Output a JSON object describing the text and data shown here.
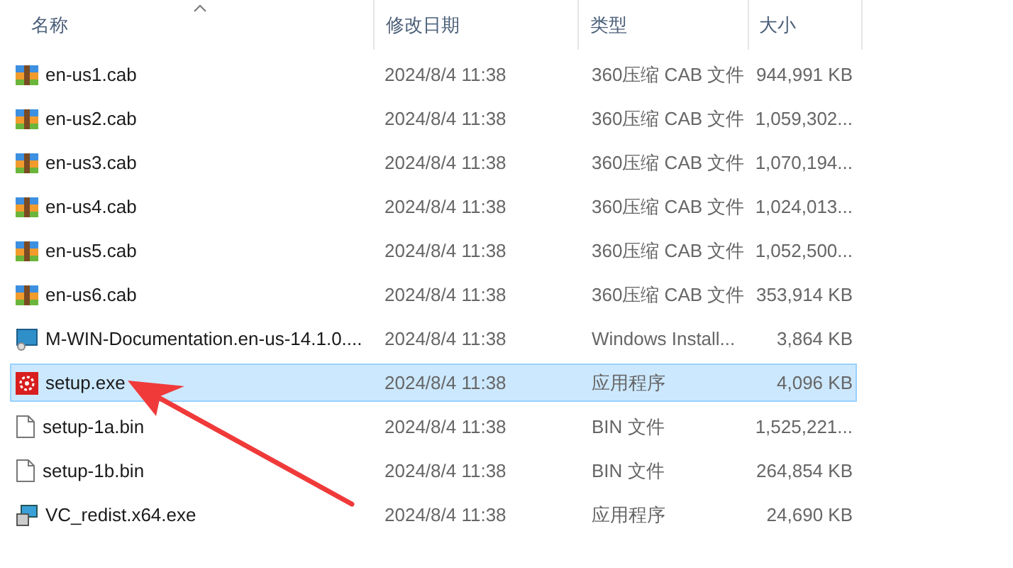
{
  "columns": [
    {
      "label": "名称",
      "sorted": true
    },
    {
      "label": "修改日期",
      "sorted": false
    },
    {
      "label": "类型",
      "sorted": false
    },
    {
      "label": "大小",
      "sorted": false
    }
  ],
  "rows": [
    {
      "kind": "archive",
      "name": "en-us1.cab",
      "date": "2024/8/4 11:38",
      "type": "360压缩 CAB 文件",
      "size": "944,991 KB",
      "selected": false
    },
    {
      "kind": "archive",
      "name": "en-us2.cab",
      "date": "2024/8/4 11:38",
      "type": "360压缩 CAB 文件",
      "size": "1,059,302...",
      "selected": false
    },
    {
      "kind": "archive",
      "name": "en-us3.cab",
      "date": "2024/8/4 11:38",
      "type": "360压缩 CAB 文件",
      "size": "1,070,194...",
      "selected": false
    },
    {
      "kind": "archive",
      "name": "en-us4.cab",
      "date": "2024/8/4 11:38",
      "type": "360压缩 CAB 文件",
      "size": "1,024,013...",
      "selected": false
    },
    {
      "kind": "archive",
      "name": "en-us5.cab",
      "date": "2024/8/4 11:38",
      "type": "360压缩 CAB 文件",
      "size": "1,052,500...",
      "selected": false
    },
    {
      "kind": "archive",
      "name": "en-us6.cab",
      "date": "2024/8/4 11:38",
      "type": "360压缩 CAB 文件",
      "size": "353,914 KB",
      "selected": false
    },
    {
      "kind": "installer",
      "name": "M-WIN-Documentation.en-us-14.1.0....",
      "date": "2024/8/4 11:38",
      "type": "Windows Install...",
      "size": "3,864 KB",
      "selected": false
    },
    {
      "kind": "app",
      "name": "setup.exe",
      "date": "2024/8/4 11:38",
      "type": "应用程序",
      "size": "4,096 KB",
      "selected": true
    },
    {
      "kind": "file",
      "name": "setup-1a.bin",
      "date": "2024/8/4 11:38",
      "type": "BIN 文件",
      "size": "1,525,221...",
      "selected": false
    },
    {
      "kind": "file",
      "name": "setup-1b.bin",
      "date": "2024/8/4 11:38",
      "type": "BIN 文件",
      "size": "264,854 KB",
      "selected": false
    },
    {
      "kind": "package",
      "name": "VC_redist.x64.exe",
      "date": "2024/8/4 11:38",
      "type": "应用程序",
      "size": "24,690 KB",
      "selected": false
    }
  ]
}
